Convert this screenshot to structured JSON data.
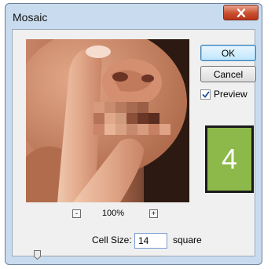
{
  "window": {
    "title": "Mosaic",
    "close_icon": "close-icon"
  },
  "buttons": {
    "ok_label": "OK",
    "cancel_label": "Cancel"
  },
  "preview_option": {
    "label": "Preview",
    "checked": true
  },
  "badge": {
    "text": "4",
    "color": "#8db84a"
  },
  "zoom": {
    "level": "100%",
    "minus": "-",
    "plus": "+"
  },
  "cell_size": {
    "label": "Cell Size:",
    "value": "14",
    "unit": "square",
    "slider_position": 0.02
  },
  "colors": {
    "accent": "#3c7fb1",
    "title_bar": "#c9dcef",
    "close_button": "#c9502f"
  }
}
